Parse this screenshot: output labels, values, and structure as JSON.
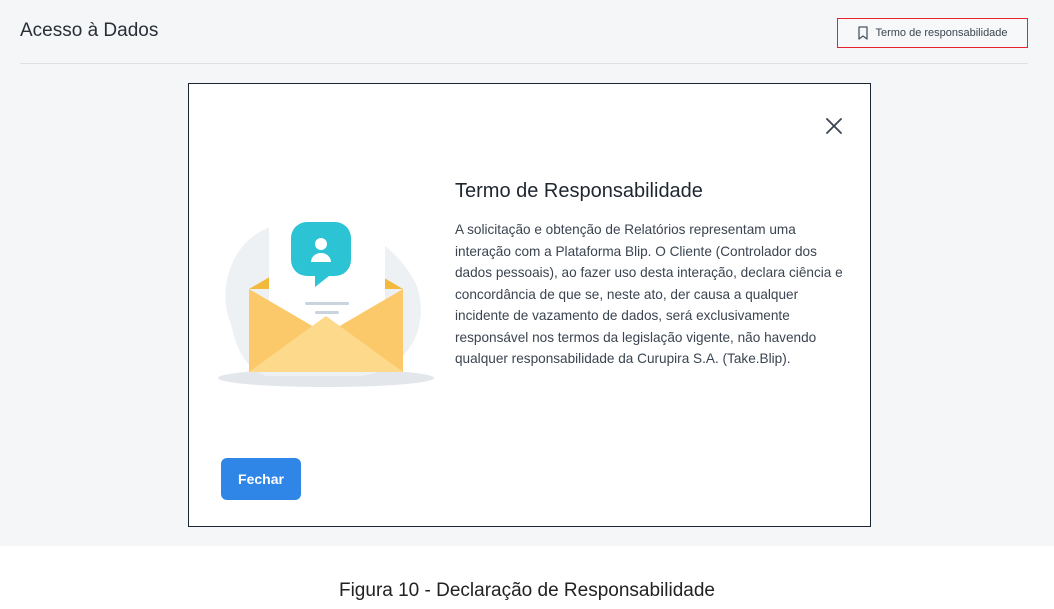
{
  "header": {
    "title": "Acesso à Dados",
    "term_link_label": "Termo de responsabilidade",
    "term_link_icon": "bookmark-icon",
    "highlight_color": "#e4232d"
  },
  "modal": {
    "title": "Termo de Responsabilidade",
    "body": "A solicitação e obtenção de Relatórios representam uma interação com a Plataforma Blip. O Cliente (Controlador dos dados pessoais), ao fazer uso desta interação, declara ciência e concordância de que se, neste ato, der causa a qualquer incidente de vazamento de dados, será exclusivamente responsável nos termos da legislação vigente, não havendo qualquer responsabilidade da Curupira S.A. (Take.Blip).",
    "close_icon": "close-icon",
    "illustration": "envelope-letter-user-icon",
    "button_label": "Fechar",
    "button_color": "#2f86e6"
  },
  "caption": "Figura 10 - Declaração de Responsabilidade"
}
